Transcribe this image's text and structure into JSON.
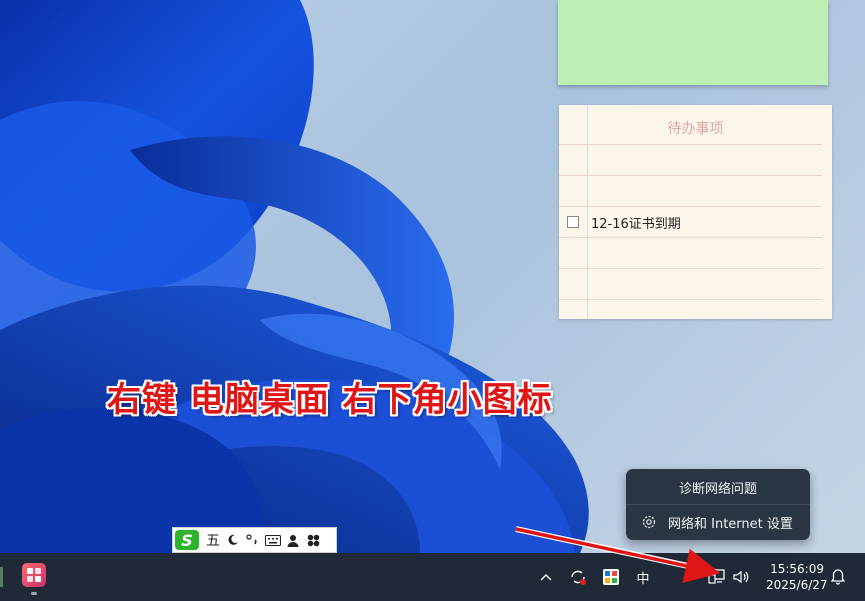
{
  "todo_note": {
    "title": "待办事项",
    "items": [
      {
        "text": "12-16证书到期",
        "checked": false
      }
    ]
  },
  "caption": "右键 电脑桌面 右下角小图标",
  "context_menu": {
    "items": [
      {
        "label": "诊断网络问题",
        "icon": null
      },
      {
        "label": "网络和 Internet 设置",
        "icon": "gear-icon"
      }
    ]
  },
  "ime_toolbar": {
    "logo": "S",
    "mode_label": "五",
    "icons": [
      "moon-icon",
      "punctuation-icon",
      "keyboard-icon",
      "user-icon",
      "clover-icon"
    ]
  },
  "taskbar": {
    "tray": {
      "overflow_icon": "chevron-up-icon",
      "input_indicator": "中",
      "icons": [
        "sync-icon",
        "app-grid-icon",
        "network-icon",
        "volume-icon",
        "notification-bell-icon"
      ]
    },
    "clock": {
      "time": "15:56:09",
      "date": "2025/6/27"
    }
  },
  "colors": {
    "caption": "#e01515",
    "taskbar": "#1f2937",
    "menu_bg": "#2a3644",
    "sticky_green": "#bdeeb4",
    "todo_bg": "#fcf6ea"
  }
}
